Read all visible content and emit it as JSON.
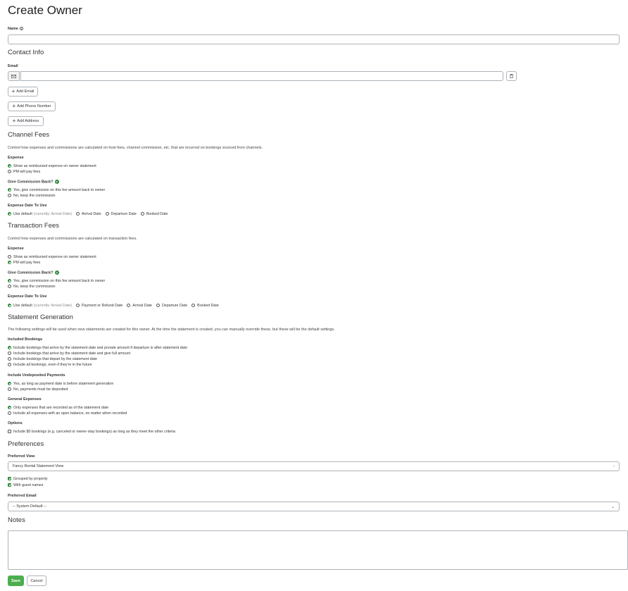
{
  "title": "Create Owner",
  "name": {
    "label": "Name",
    "value": ""
  },
  "contact": {
    "heading": "Contact Info",
    "email_label": "Email",
    "email_value": "",
    "add_email": "Add Email",
    "add_phone": "Add Phone Number",
    "add_address": "Add Address"
  },
  "channel_fees": {
    "heading": "Channel Fees",
    "description": "Control how expenses and commissions are calculated on host fees, channel commission, etc. that are incurred on bookings sourced from channels.",
    "expense_label": "Expense",
    "expense_options": [
      "Show as reimbursed expense on owner statement",
      "PM will pay fees"
    ],
    "commission_label": "Give Commission Back?",
    "commission_options": [
      "Yes, give commission on this fee amount back to owner",
      "No, keep the commission"
    ],
    "date_label": "Expense Date To Use",
    "date_default": "Use default",
    "date_default_note": "(currently: Arrival Date)",
    "date_options": [
      "Arrival Date",
      "Departure Date",
      "Booked Date"
    ]
  },
  "transaction_fees": {
    "heading": "Transaction Fees",
    "description": "Control how expenses and commissions are calculated on transaction fees.",
    "expense_label": "Expense",
    "expense_options": [
      "Show as reimbursed expense on owner statement",
      "PM will pay fees"
    ],
    "commission_label": "Give Commission Back?",
    "commission_options": [
      "Yes, give commission on this fee amount back to owner",
      "No, keep the commission"
    ],
    "date_label": "Expense Date To Use",
    "date_default": "Use default",
    "date_default_note": "(currently: Arrival Date)",
    "date_options": [
      "Payment or Refund Date",
      "Arrival Date",
      "Departure Date",
      "Booked Date"
    ]
  },
  "statement": {
    "heading": "Statement Generation",
    "description": "The following settings will be used when new statements are created for this owner. At the time the statement is created, you can manually override these, but these will be the default settings.",
    "included_label": "Included Bookings",
    "included_options": [
      "Include bookings that arrive by the statement date and prorate amount if departure is after statement date",
      "Include bookings that arrive by the statement date and give full amount",
      "Include bookings that depart by the statement date",
      "Include all bookings, even if they're in the future"
    ],
    "undeposited_label": "Include Undeposited Payments",
    "undeposited_options": [
      "Yes, as long as payment date is before statement generation",
      "No, payments must be deposited"
    ],
    "general_label": "General Expenses",
    "general_options": [
      "Only expenses that are recorded as of the statement date",
      "Include all expenses with an open balance, no matter when recorded"
    ],
    "options_label": "Options",
    "options_zero": "Include $0 bookings (e.g. canceled or owner-stay bookings) as long as they meet the other criteria"
  },
  "preferences": {
    "heading": "Preferences",
    "view_label": "Preferred View",
    "view_value": "Fancy Rental Statement View",
    "grouped": "Grouped by property",
    "guest_names": "With guest names",
    "email_label": "Preferred Email",
    "email_value": "-- System Default --"
  },
  "notes": {
    "heading": "Notes",
    "value": ""
  },
  "actions": {
    "save": "Save",
    "cancel": "Cancel"
  },
  "colors": {
    "accent": "#2e8b3a",
    "save": "#4cae4f",
    "border": "#aeb4ba"
  }
}
